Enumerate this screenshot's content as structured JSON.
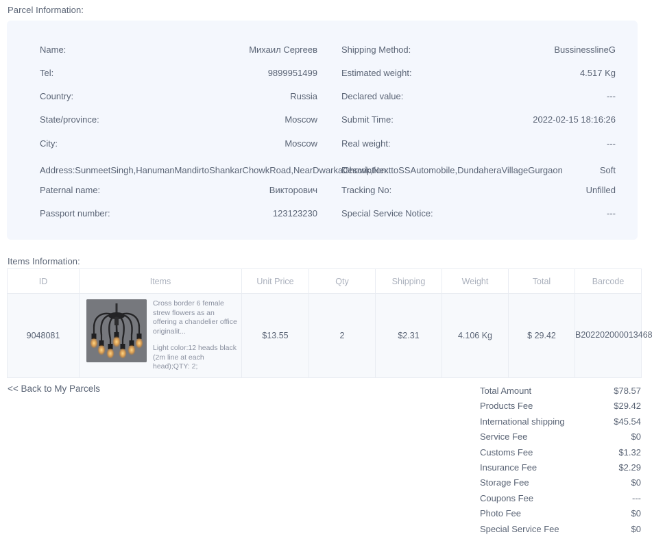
{
  "parcel": {
    "section_title": "Parcel Information:",
    "left_fields": [
      {
        "label": "Name:",
        "value": "Михаил Сергеев"
      },
      {
        "label": "Tel:",
        "value": "9899951499"
      },
      {
        "label": "Country:",
        "value": "Russia"
      },
      {
        "label": "State/province:",
        "value": "Moscow"
      },
      {
        "label": "City:",
        "value": "Moscow"
      }
    ],
    "right_fields": [
      {
        "label": "Shipping Method:",
        "value": "BussinesslineG"
      },
      {
        "label": "Estimated weight:",
        "value": "4.517 Kg"
      },
      {
        "label": "Declared value:",
        "value": "---"
      },
      {
        "label": "Submit Time:",
        "value": "2022-02-15 18:16:26"
      },
      {
        "label": "Real weight:",
        "value": "---"
      }
    ],
    "address_row": {
      "address_text": "Address:SunmeetSingh,HanumanMandirtoShankarChowkRoad,NearDwarkaChowk,NexttoSSAutomobile,DundaheraVillageGurgaon",
      "description_label": "Description:",
      "description_value": "Soft"
    },
    "bottom_left_fields": [
      {
        "label": "Paternal name:",
        "value": "Викторович"
      },
      {
        "label": "Passport number:",
        "value": "123123230"
      }
    ],
    "bottom_right_fields": [
      {
        "label": "Tracking No:",
        "value": "Unfilled"
      },
      {
        "label": "Special Service Notice:",
        "value": "---"
      }
    ]
  },
  "items": {
    "section_title": "Items Information:",
    "columns": [
      "ID",
      "Items",
      "Unit Price",
      "Qty",
      "Shipping",
      "Weight",
      "Total",
      "Barcode"
    ],
    "rows": [
      {
        "id": "9048081",
        "title": "Cross border 6 female strew flowers as an offering a chandelier office originalit...",
        "attributes": "Light color:12 heads black (2m line at each head);QTY: 2;",
        "thumbnail_icon": "chandelier-lamp-photo",
        "unit_price": "$13.55",
        "qty": "2",
        "shipping": "$2.31",
        "weight": "4.106 Kg",
        "total": "$ 29.42",
        "barcode": "B202202000013468"
      }
    ]
  },
  "footer": {
    "back_link": "<< Back to My Parcels",
    "totals": [
      {
        "label": "Total Amount",
        "value": "$78.57"
      },
      {
        "label": "Products Fee",
        "value": "$29.42"
      },
      {
        "label": "International shipping",
        "value": "$45.54"
      },
      {
        "label": "Service Fee",
        "value": "$0"
      },
      {
        "label": "Customs Fee",
        "value": "$1.32"
      },
      {
        "label": "Insurance Fee",
        "value": "$2.29"
      },
      {
        "label": "Storage Fee",
        "value": "$0"
      },
      {
        "label": "Coupons Fee",
        "value": "---"
      },
      {
        "label": "Photo Fee",
        "value": "$0"
      },
      {
        "label": "Special Service Fee",
        "value": "$0"
      }
    ]
  },
  "colors": {
    "panel_bg": "#f4f7fd",
    "text": "#5a6475",
    "muted": "#aab0bc",
    "border": "#e9ecf2",
    "row_bg": "#f7f9fc"
  }
}
